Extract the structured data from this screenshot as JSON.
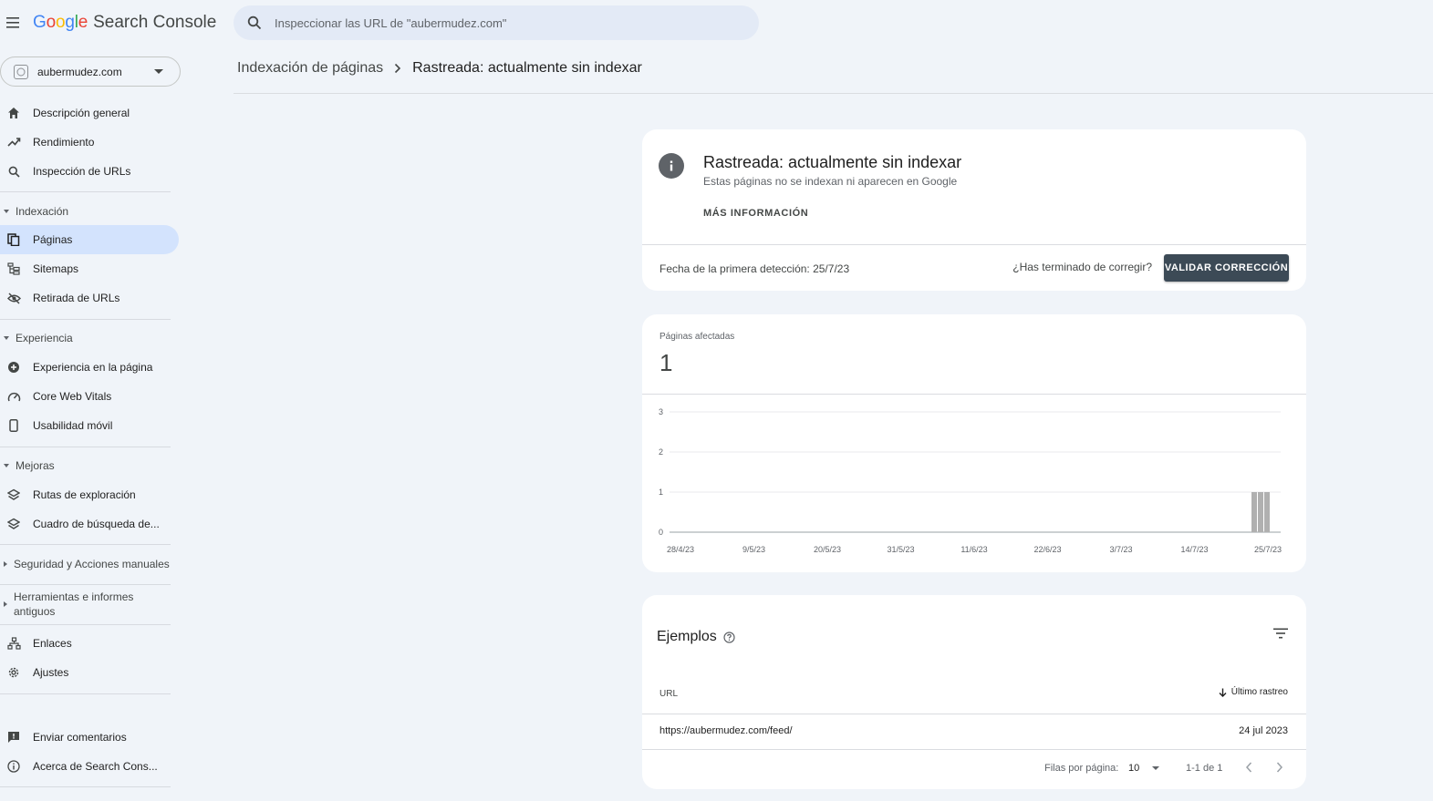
{
  "app": {
    "logo_google": "Google",
    "logo_product": "Search Console",
    "search_placeholder": "Inspeccionar las URL de \"aubermudez.com\""
  },
  "property": {
    "name": "aubermudez.com"
  },
  "sidebar": {
    "top_items": [
      {
        "label": "Descripción general",
        "icon": "home-icon"
      },
      {
        "label": "Rendimiento",
        "icon": "trending-icon"
      },
      {
        "label": "Inspección de URLs",
        "icon": "search-icon"
      }
    ],
    "sections": {
      "indexing": "Indexación",
      "experience": "Experiencia",
      "improvements": "Mejoras",
      "security": "Seguridad y Acciones manuales",
      "tools": "Herramientas e informes antiguos"
    },
    "indexing_items": [
      {
        "label": "Páginas",
        "icon": "pages-icon",
        "active": true
      },
      {
        "label": "Sitemaps",
        "icon": "sitemap-icon"
      },
      {
        "label": "Retirada de URLs",
        "icon": "eye-off-icon"
      }
    ],
    "experience_items": [
      {
        "label": "Experiencia en la página",
        "icon": "plus-circle-icon"
      },
      {
        "label": "Core Web Vitals",
        "icon": "gauge-icon"
      },
      {
        "label": "Usabilidad móvil",
        "icon": "phone-icon"
      }
    ],
    "improvements_items": [
      {
        "label": "Rutas de exploración",
        "icon": "layers-icon"
      },
      {
        "label": "Cuadro de búsqueda de...",
        "icon": "layers-icon"
      }
    ],
    "other_items": [
      {
        "label": "Enlaces",
        "icon": "links-icon"
      },
      {
        "label": "Ajustes",
        "icon": "gear-icon"
      }
    ],
    "footer_items": [
      {
        "label": "Enviar comentarios",
        "icon": "feedback-icon"
      },
      {
        "label": "Acerca de Search Cons...",
        "icon": "info-icon"
      }
    ]
  },
  "breadcrumb": {
    "parent": "Indexación de páginas",
    "current": "Rastreada: actualmente sin indexar"
  },
  "issue_card": {
    "title": "Rastreada: actualmente sin indexar",
    "subtitle": "Estas páginas no se indexan ni aparecen en Google",
    "more_info": "MÁS INFORMACIÓN",
    "first_detected": "Fecha de la primera detección: 25/7/23",
    "ask": "¿Has terminado de corregir?",
    "validate_label": "VALIDAR CORRECCIÓN"
  },
  "chart_card": {
    "label": "Páginas afectadas",
    "value": "1"
  },
  "chart_data": {
    "type": "bar",
    "title": "",
    "xlabel": "",
    "ylabel": "",
    "ylim": [
      0,
      3
    ],
    "y_ticks": [
      "0",
      "1",
      "2",
      "3"
    ],
    "x_ticks": [
      "28/4/23",
      "9/5/23",
      "20/5/23",
      "31/5/23",
      "11/6/23",
      "22/6/23",
      "3/7/23",
      "14/7/23",
      "25/7/23"
    ],
    "categories": [
      "25/7/23",
      "26/7/23",
      "27/7/23"
    ],
    "values": [
      1,
      1,
      1
    ],
    "bar_color": "#b0b0b0",
    "grid": true
  },
  "examples": {
    "title": "Ejemplos",
    "col_url": "URL",
    "col_last": "Último rastreo",
    "rows": [
      {
        "url": "https://aubermudez.com/feed/",
        "date": "24 jul 2023"
      }
    ],
    "rows_per_page_label": "Filas por página:",
    "rows_per_page": "10",
    "range": "1-1 de 1"
  }
}
